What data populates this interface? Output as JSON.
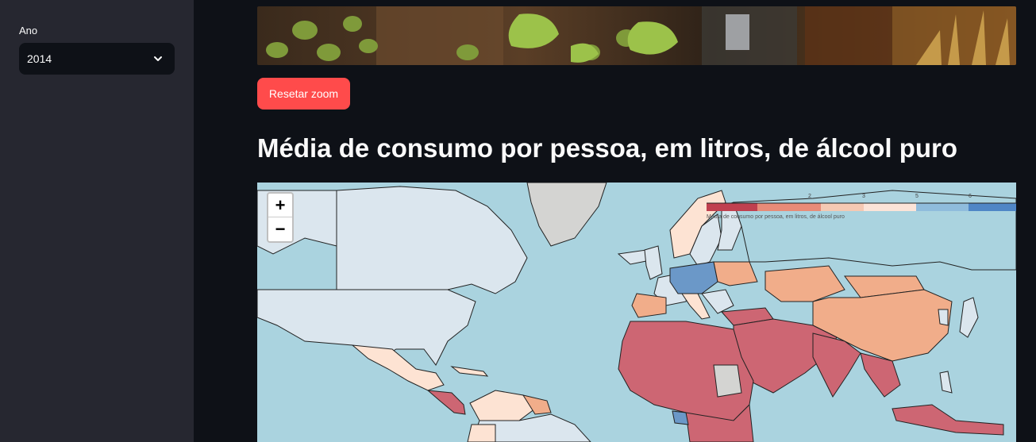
{
  "sidebar": {
    "year_label": "Ano",
    "year_value": "2014",
    "chevron_icon": "chevron-down-icon"
  },
  "main": {
    "reset_button_label": "Resetar zoom",
    "heading": "Média de consumo por pessoa, em litros, de álcool puro"
  },
  "map": {
    "zoom_in_label": "+",
    "zoom_out_label": "−",
    "legend": {
      "caption": "Média de consumo por pessoa, em litros, de álcool puro",
      "ticks": [
        "2",
        "3",
        "5",
        "6"
      ],
      "colors": [
        "#c0404f",
        "#e88b78",
        "#f5c9b3",
        "#fbe4d8",
        "#8fbcdc",
        "#4f86c6"
      ]
    },
    "colors": {
      "water": "#aad3df",
      "high": "#cd6673",
      "mid": "#f1ad8a",
      "light": "#fde3d3",
      "pale": "#dbe6ee",
      "blue": "#6b98c8",
      "nodata": "#d4d4d2"
    }
  }
}
